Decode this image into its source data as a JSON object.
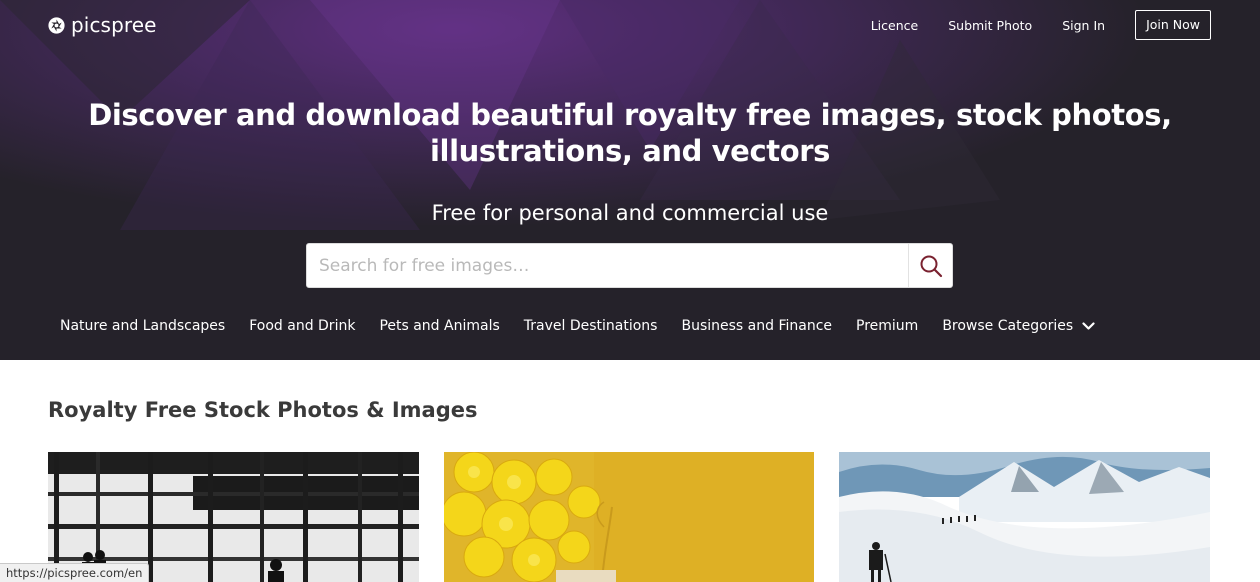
{
  "header": {
    "logo_text": "picspree",
    "nav": [
      {
        "label": "Licence"
      },
      {
        "label": "Submit Photo"
      },
      {
        "label": "Sign In"
      },
      {
        "label": "Join Now"
      }
    ]
  },
  "hero": {
    "headline": "Discover and download beautiful royalty free images, stock photos, illustrations, and vectors",
    "subheadline": "Free for personal and commercial use",
    "search": {
      "placeholder": "Search for free images…",
      "value": "",
      "icon": "search-icon"
    }
  },
  "categories": [
    {
      "label": "Nature and Landscapes"
    },
    {
      "label": "Food and Drink"
    },
    {
      "label": "Pets and Animals"
    },
    {
      "label": "Travel Destinations"
    },
    {
      "label": "Business and Finance"
    },
    {
      "label": "Premium"
    },
    {
      "label": "Browse Categories",
      "icon": "chevron-down-icon"
    }
  ],
  "main": {
    "section_title": "Royalty Free Stock Photos & Images"
  },
  "status_bar": {
    "url": "https://picspree.com/en"
  },
  "colors": {
    "hero_dark": "#25222a",
    "hero_purple": "#5b2e7a",
    "search_icon": "#7a2230",
    "text_dark": "#3a3a3a"
  }
}
